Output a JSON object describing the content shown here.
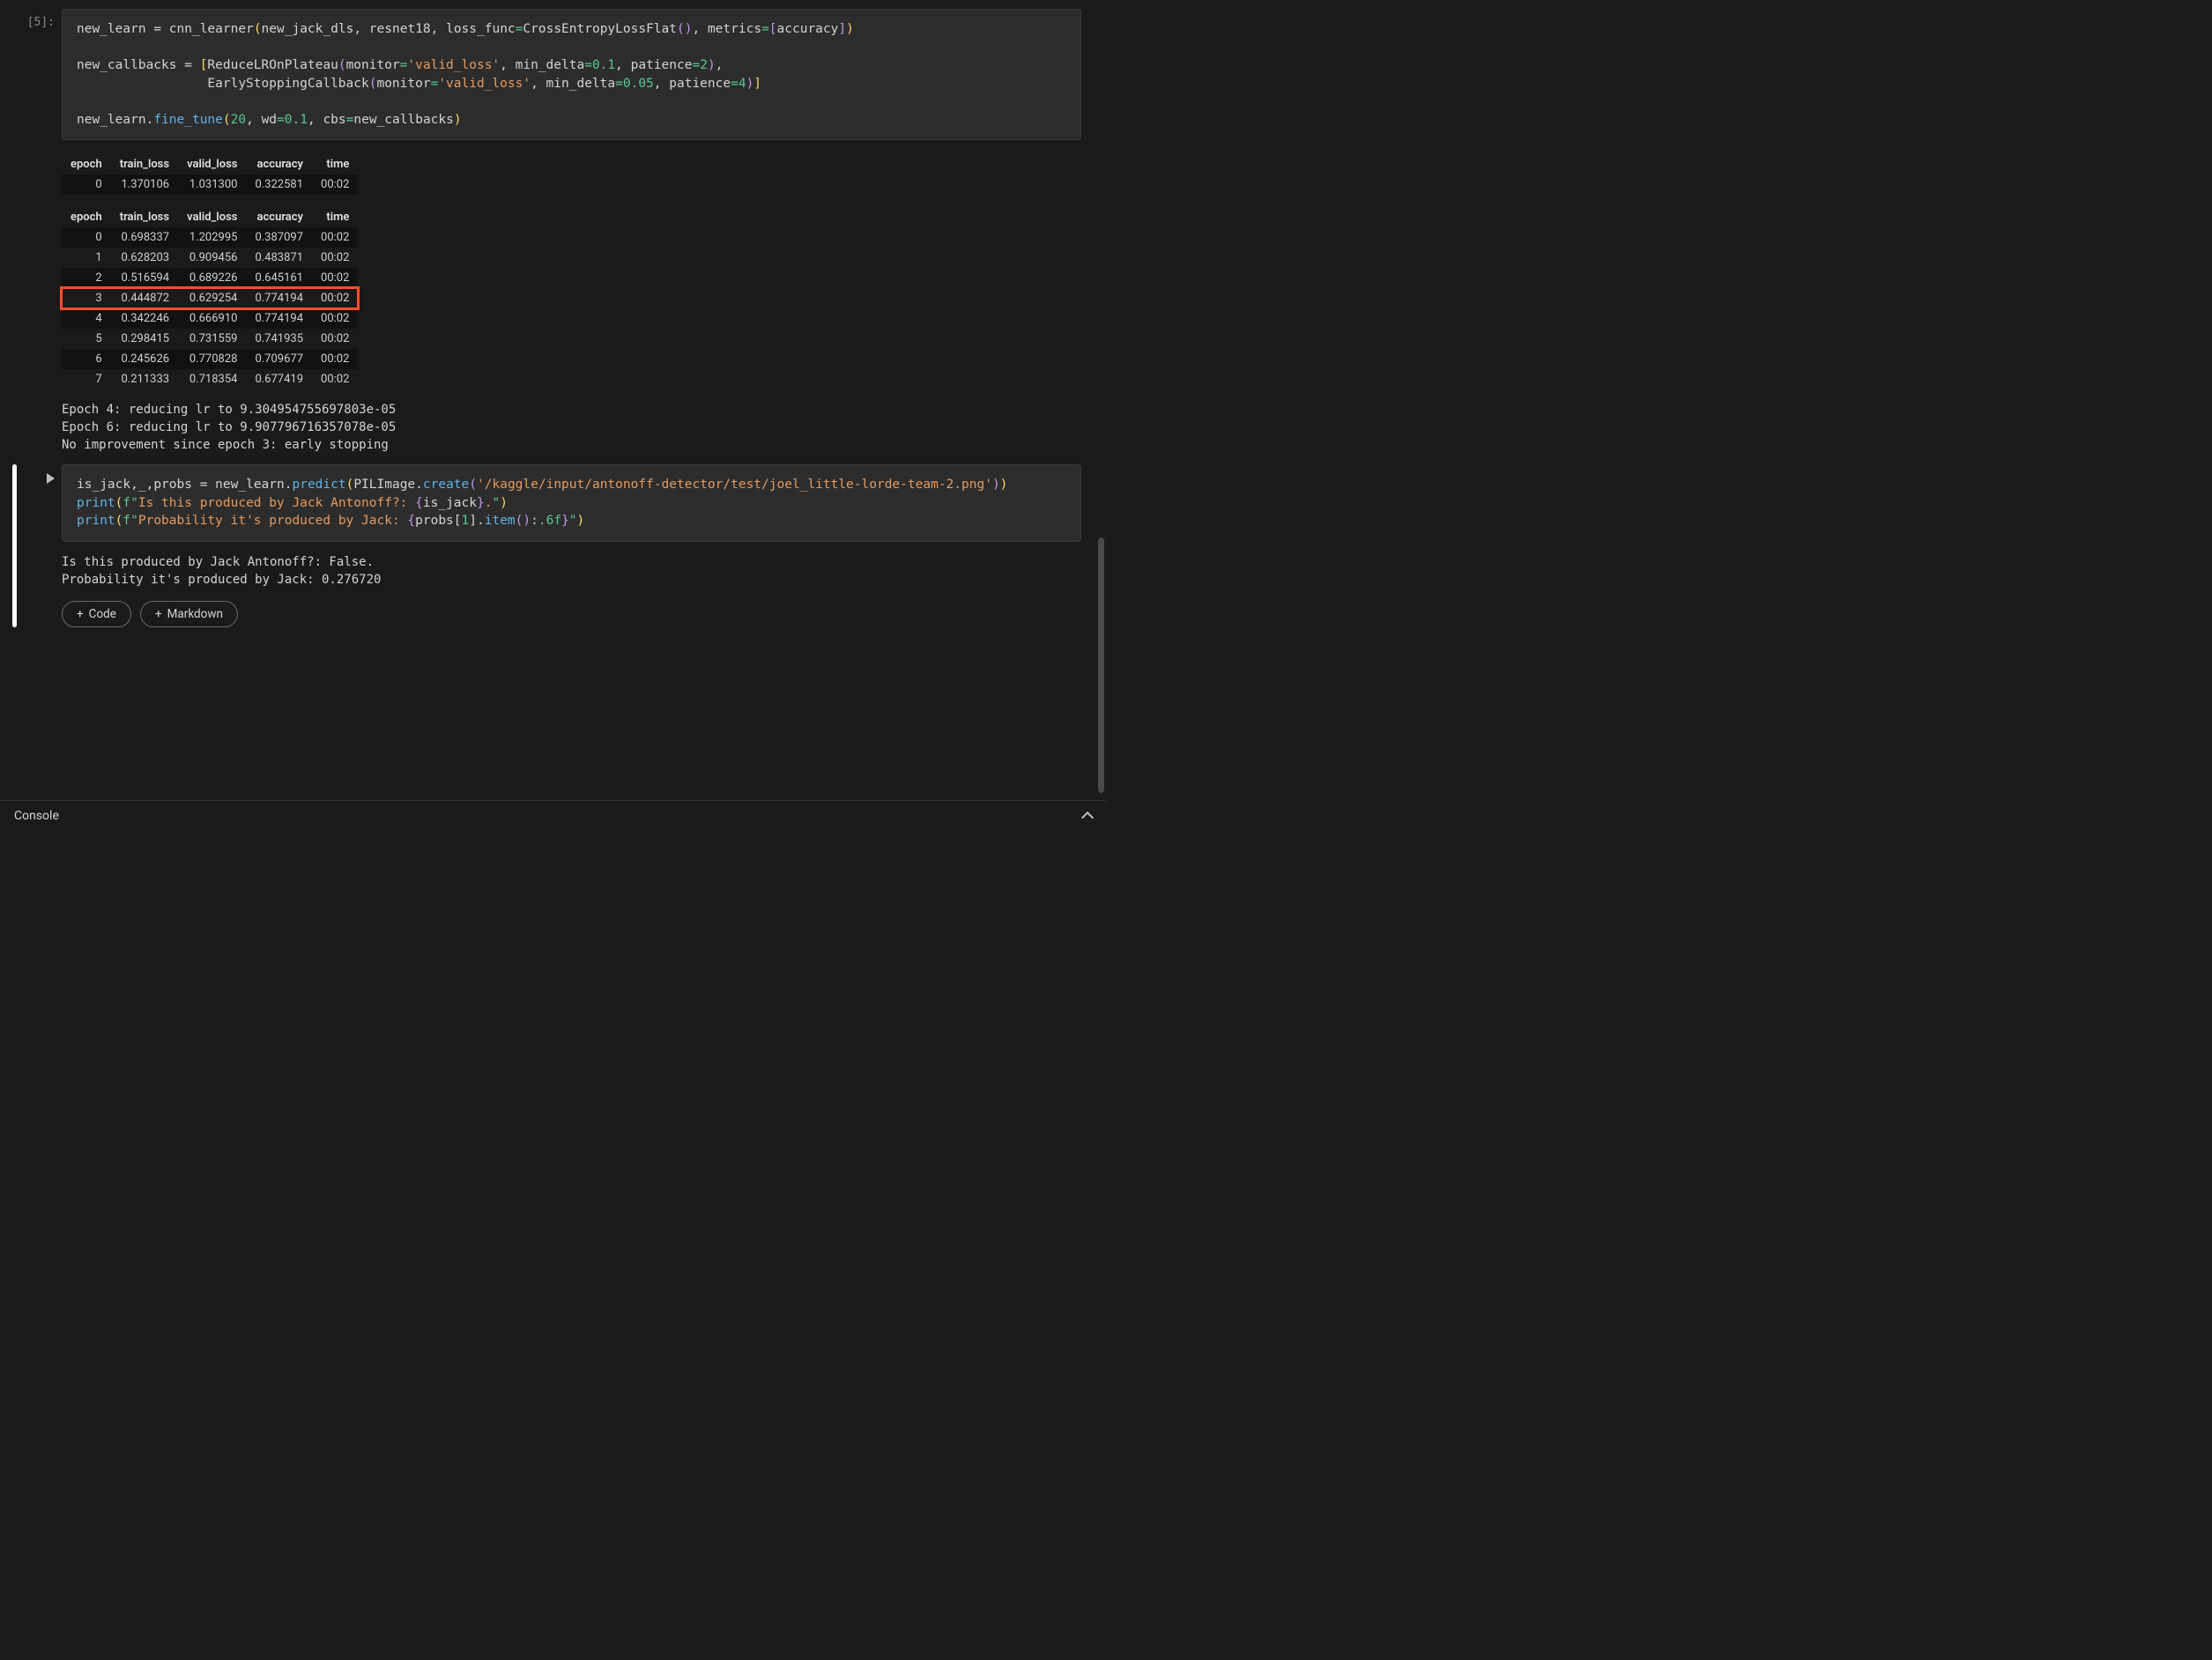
{
  "cells": [
    {
      "prompt": "[5]:",
      "selected": false,
      "code_tokens": [
        [
          "id",
          "new_learn "
        ],
        [
          "op",
          "= "
        ],
        [
          "id",
          "cnn_learner"
        ],
        [
          "br",
          "("
        ],
        [
          "id",
          "new_jack_dls"
        ],
        [
          "op",
          ", "
        ],
        [
          "id",
          "resnet18"
        ],
        [
          "op",
          ", "
        ],
        [
          "id",
          "loss_func"
        ],
        [
          "eq",
          "="
        ],
        [
          "id",
          "CrossEntropyLossFlat"
        ],
        [
          "b2",
          "()"
        ],
        [
          "op",
          ", "
        ],
        [
          "id",
          "metrics"
        ],
        [
          "eq",
          "="
        ],
        [
          "b2",
          "["
        ],
        [
          "id",
          "accuracy"
        ],
        [
          "b2",
          "]"
        ],
        [
          "br",
          ")"
        ],
        [
          "nl",
          ""
        ],
        [
          "nl",
          ""
        ],
        [
          "id",
          "new_callbacks "
        ],
        [
          "op",
          "= "
        ],
        [
          "br",
          "["
        ],
        [
          "id",
          "ReduceLROnPlateau"
        ],
        [
          "b2",
          "("
        ],
        [
          "id",
          "monitor"
        ],
        [
          "eq",
          "="
        ],
        [
          "str",
          "'valid_loss'"
        ],
        [
          "op",
          ", "
        ],
        [
          "id",
          "min_delta"
        ],
        [
          "eq",
          "="
        ],
        [
          "num",
          "0.1"
        ],
        [
          "op",
          ", "
        ],
        [
          "id",
          "patience"
        ],
        [
          "eq",
          "="
        ],
        [
          "num",
          "2"
        ],
        [
          "b2",
          ")"
        ],
        [
          "op",
          ","
        ],
        [
          "nl",
          ""
        ],
        [
          "id",
          "                 EarlyStoppingCallback"
        ],
        [
          "b2",
          "("
        ],
        [
          "id",
          "monitor"
        ],
        [
          "eq",
          "="
        ],
        [
          "str",
          "'valid_loss'"
        ],
        [
          "op",
          ", "
        ],
        [
          "id",
          "min_delta"
        ],
        [
          "eq",
          "="
        ],
        [
          "num",
          "0.05"
        ],
        [
          "op",
          ", "
        ],
        [
          "id",
          "patience"
        ],
        [
          "eq",
          "="
        ],
        [
          "num",
          "4"
        ],
        [
          "b2",
          ")"
        ],
        [
          "br",
          "]"
        ],
        [
          "nl",
          ""
        ],
        [
          "nl",
          ""
        ],
        [
          "id",
          "new_learn"
        ],
        [
          "op",
          "."
        ],
        [
          "fn",
          "fine_tune"
        ],
        [
          "br",
          "("
        ],
        [
          "num",
          "20"
        ],
        [
          "op",
          ", "
        ],
        [
          "id",
          "wd"
        ],
        [
          "eq",
          "="
        ],
        [
          "num",
          "0.1"
        ],
        [
          "op",
          ", "
        ],
        [
          "id",
          "cbs"
        ],
        [
          "eq",
          "="
        ],
        [
          "id",
          "new_callbacks"
        ],
        [
          "br",
          ")"
        ]
      ],
      "output": {
        "tables": [
          {
            "headers": [
              "epoch",
              "train_loss",
              "valid_loss",
              "accuracy",
              "time"
            ],
            "rows": [
              {
                "cells": [
                  "0",
                  "1.370106",
                  "1.031300",
                  "0.322581",
                  "00:02"
                ],
                "highlight": false
              }
            ]
          },
          {
            "headers": [
              "epoch",
              "train_loss",
              "valid_loss",
              "accuracy",
              "time"
            ],
            "rows": [
              {
                "cells": [
                  "0",
                  "0.698337",
                  "1.202995",
                  "0.387097",
                  "00:02"
                ],
                "highlight": false
              },
              {
                "cells": [
                  "1",
                  "0.628203",
                  "0.909456",
                  "0.483871",
                  "00:02"
                ],
                "highlight": false
              },
              {
                "cells": [
                  "2",
                  "0.516594",
                  "0.689226",
                  "0.645161",
                  "00:02"
                ],
                "highlight": false
              },
              {
                "cells": [
                  "3",
                  "0.444872",
                  "0.629254",
                  "0.774194",
                  "00:02"
                ],
                "highlight": true
              },
              {
                "cells": [
                  "4",
                  "0.342246",
                  "0.666910",
                  "0.774194",
                  "00:02"
                ],
                "highlight": false
              },
              {
                "cells": [
                  "5",
                  "0.298415",
                  "0.731559",
                  "0.741935",
                  "00:02"
                ],
                "highlight": false
              },
              {
                "cells": [
                  "6",
                  "0.245626",
                  "0.770828",
                  "0.709677",
                  "00:02"
                ],
                "highlight": false
              },
              {
                "cells": [
                  "7",
                  "0.211333",
                  "0.718354",
                  "0.677419",
                  "00:02"
                ],
                "highlight": false
              }
            ]
          }
        ],
        "stdout": "Epoch 4: reducing lr to 9.304954755697803e-05\nEpoch 6: reducing lr to 9.907796716357078e-05\nNo improvement since epoch 3: early stopping"
      }
    },
    {
      "prompt": "",
      "selected": true,
      "running": true,
      "code_tokens": [
        [
          "id",
          "is_jack"
        ],
        [
          "op",
          ","
        ],
        [
          "id",
          "_"
        ],
        [
          "op",
          ","
        ],
        [
          "id",
          "probs "
        ],
        [
          "op",
          "= "
        ],
        [
          "id",
          "new_learn"
        ],
        [
          "op",
          "."
        ],
        [
          "fn",
          "predict"
        ],
        [
          "br",
          "("
        ],
        [
          "id",
          "PILImage"
        ],
        [
          "op",
          "."
        ],
        [
          "fn",
          "create"
        ],
        [
          "b2",
          "("
        ],
        [
          "str",
          "'/kaggle/input/antonoff-detector/test/joel_little-lorde-team-2.png'"
        ],
        [
          "b2",
          ")"
        ],
        [
          "br",
          ")"
        ],
        [
          "nl",
          ""
        ],
        [
          "fn",
          "print"
        ],
        [
          "br",
          "("
        ],
        [
          "kw",
          "f\""
        ],
        [
          "str",
          "Is this produced by Jack Antonoff?: "
        ],
        [
          "b2",
          "{"
        ],
        [
          "id",
          "is_jack"
        ],
        [
          "b2",
          "}"
        ],
        [
          "str",
          "."
        ],
        [
          "kw",
          "\""
        ],
        [
          "br",
          ")"
        ],
        [
          "nl",
          ""
        ],
        [
          "fn",
          "print"
        ],
        [
          "br",
          "("
        ],
        [
          "kw",
          "f\""
        ],
        [
          "str",
          "Probability it's produced by Jack: "
        ],
        [
          "b2",
          "{"
        ],
        [
          "id",
          "probs"
        ],
        [
          "op",
          "["
        ],
        [
          "num",
          "1"
        ],
        [
          "op",
          "]."
        ],
        [
          "fn",
          "item"
        ],
        [
          "b2",
          "()"
        ],
        [
          "op",
          ":"
        ],
        [
          "num",
          ".6f"
        ],
        [
          "b2",
          "}"
        ],
        [
          "kw",
          "\""
        ],
        [
          "br",
          ")"
        ]
      ],
      "output": {
        "tables": [],
        "stdout": "Is this produced by Jack Antonoff?: False.\nProbability it's produced by Jack: 0.276720"
      },
      "add_buttons": {
        "code": "Code",
        "markdown": "Markdown"
      }
    }
  ],
  "console": {
    "label": "Console"
  }
}
